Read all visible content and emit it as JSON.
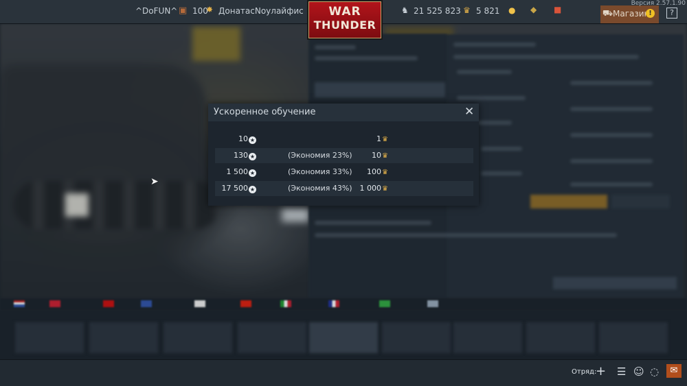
{
  "header": {
    "squad_tag": "^DoFUN^",
    "level": "100",
    "player_name": "ДонатасNоулайфис",
    "silver_lions": "21 525 823",
    "golden_eagles": "5 821",
    "shop_label": "Магазин",
    "version": "Версия 2.57.1.90",
    "logo_line1": "WAR",
    "logo_line2": "THUNDER"
  },
  "modal": {
    "title": "Ускоренное обучение",
    "rows": [
      {
        "rp": "10",
        "economy": "",
        "cost": "1"
      },
      {
        "rp": "130",
        "economy": "(Экономия 23%)",
        "cost": "10"
      },
      {
        "rp": "1 500",
        "economy": "(Экономия 33%)",
        "cost": "100"
      },
      {
        "rp": "17 500",
        "economy": "(Экономия 43%)",
        "cost": "1 000"
      }
    ]
  },
  "bottom": {
    "squad_label": "Отряд:"
  },
  "icons": {
    "rp": "research-point-icon",
    "ge": "golden-eagle-icon"
  }
}
